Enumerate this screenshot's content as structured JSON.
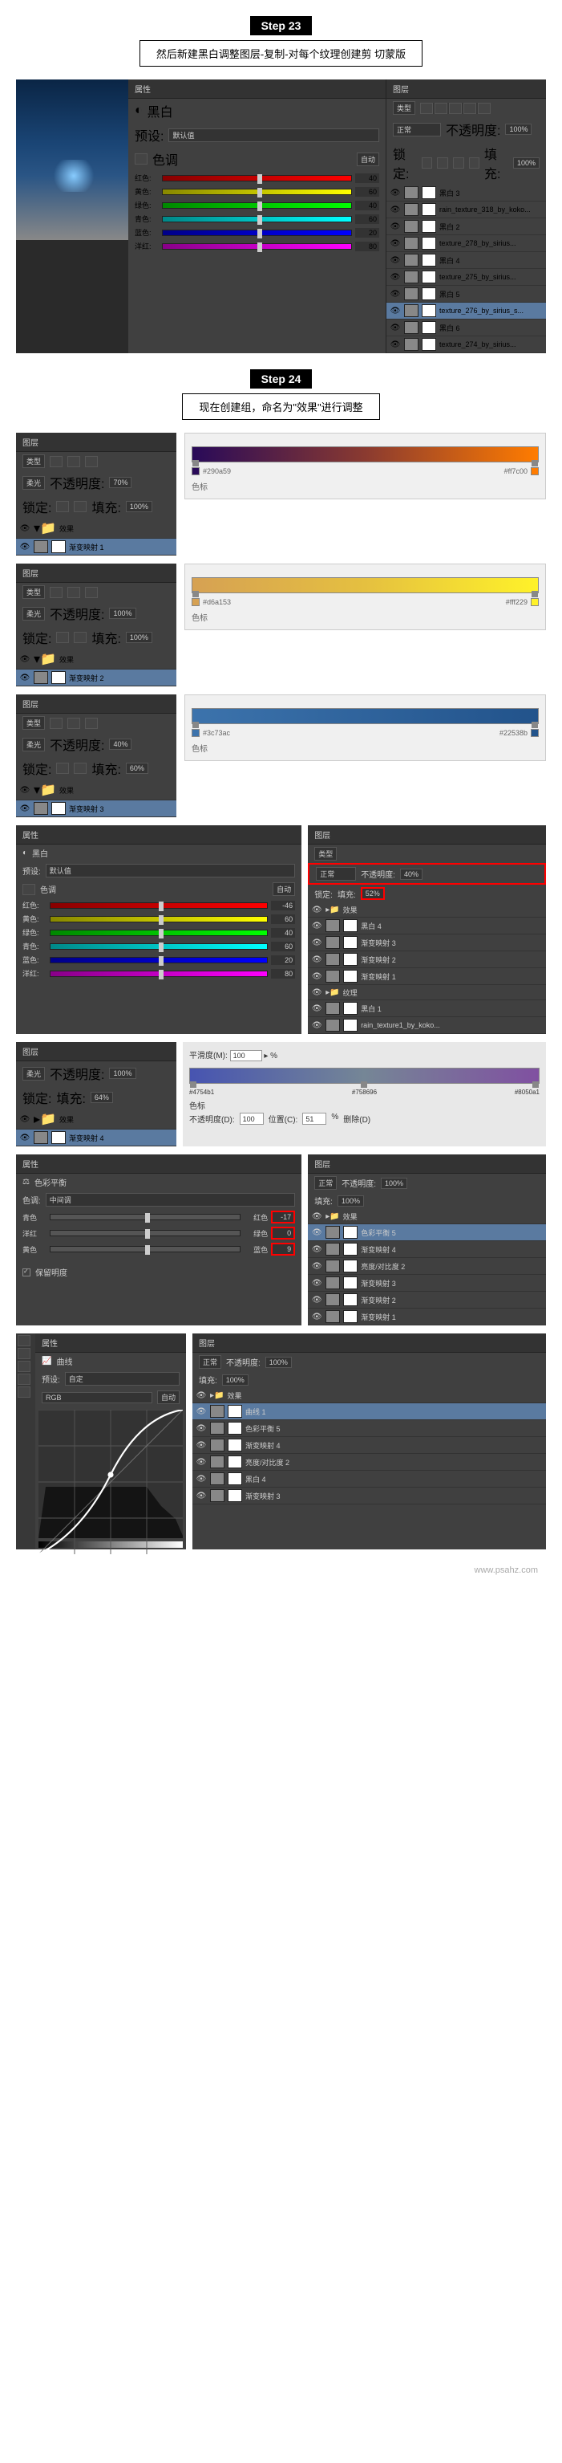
{
  "steps": {
    "s23": {
      "badge": "Step 23",
      "desc": "然后新建黑白调整图层-复制-对每个纹理创建剪\n切蒙版"
    },
    "s24": {
      "badge": "Step 24",
      "desc": "现在创建组，命名为\"效果\"进行调整"
    }
  },
  "bw_panel": {
    "title": "属性",
    "type": "黑白",
    "preset_label": "预设:",
    "preset": "默认值",
    "tint_label": "色调",
    "auto": "自动",
    "sliders": [
      {
        "label": "红色:",
        "val": "40",
        "grad": "linear-gradient(to right,#800,#f00)"
      },
      {
        "label": "黄色:",
        "val": "60",
        "grad": "linear-gradient(to right,#880,#ff0)"
      },
      {
        "label": "绿色:",
        "val": "40",
        "grad": "linear-gradient(to right,#080,#0f0)"
      },
      {
        "label": "青色:",
        "val": "60",
        "grad": "linear-gradient(to right,#088,#0ff)"
      },
      {
        "label": "蓝色:",
        "val": "20",
        "grad": "linear-gradient(to right,#008,#00f)"
      },
      {
        "label": "洋红:",
        "val": "80",
        "grad": "linear-gradient(to right,#808,#f0f)"
      }
    ]
  },
  "layers_23": {
    "title": "图层",
    "kind": "类型",
    "blend": "正常",
    "opacity_label": "不透明度:",
    "opacity": "100%",
    "lock": "锁定:",
    "fill_label": "填充:",
    "fill": "100%",
    "items": [
      {
        "name": "黑白 3",
        "sel": false
      },
      {
        "name": "rain_texture_318_by_koko...",
        "sel": false
      },
      {
        "name": "黑白 2",
        "sel": false
      },
      {
        "name": "texture_278_by_sirius...",
        "sel": false
      },
      {
        "name": "黑白 4",
        "sel": false
      },
      {
        "name": "texture_275_by_sirius...",
        "sel": false
      },
      {
        "name": "黑白 5",
        "sel": false
      },
      {
        "name": "texture_276_by_sirius_s...",
        "sel": true
      },
      {
        "name": "黑白 6",
        "sel": false
      },
      {
        "name": "texture_274_by_sirius...",
        "sel": false
      }
    ]
  },
  "gradients": [
    {
      "opacity": "70%",
      "fill": "100%",
      "layer": "渐变映射 1",
      "c1": "#290a59",
      "c2": "#ff7c00",
      "grad": "linear-gradient(to right,#290a59,#8a3a30,#ff7c00)"
    },
    {
      "opacity": "100%",
      "fill": "100%",
      "layer": "渐变映射 2",
      "c1": "#d6a153",
      "c2": "#fff229",
      "grad": "linear-gradient(to right,#d6a153,#e5c040,#fff229)"
    },
    {
      "opacity": "40%",
      "fill": "60%",
      "layer": "渐变映射 3",
      "c1": "#3c73ac",
      "c2": "#22538b",
      "grad": "linear-gradient(to right,#3c73ac,#2f639c,#22538b)"
    }
  ],
  "grad_labels": {
    "panel": "图层",
    "kind": "类型",
    "blend": "柔光",
    "opacity_label": "不透明度:",
    "lock": "锁定:",
    "fill_label": "填充:",
    "group": "效果",
    "color_label": "色标"
  },
  "bw_panel2": {
    "sliders": [
      {
        "label": "红色:",
        "val": "-46",
        "grad": "linear-gradient(to right,#800,#f00)"
      },
      {
        "label": "黄色:",
        "val": "60",
        "grad": "linear-gradient(to right,#880,#ff0)"
      },
      {
        "label": "绿色:",
        "val": "40",
        "grad": "linear-gradient(to right,#080,#0f0)"
      },
      {
        "label": "青色:",
        "val": "60",
        "grad": "linear-gradient(to right,#088,#0ff)"
      },
      {
        "label": "蓝色:",
        "val": "20",
        "grad": "linear-gradient(to right,#008,#00f)"
      },
      {
        "label": "洋红:",
        "val": "80",
        "grad": "linear-gradient(to right,#808,#f0f)"
      }
    ]
  },
  "layers_fx1": {
    "opacity": "40%",
    "fill": "52%",
    "items": [
      {
        "name": "效果",
        "folder": true
      },
      {
        "name": "黑白 4"
      },
      {
        "name": "渐变映射 3"
      },
      {
        "name": "渐变映射 2"
      },
      {
        "name": "渐变映射 1"
      },
      {
        "name": "纹理",
        "folder": true
      },
      {
        "name": "黑白 1"
      },
      {
        "name": "rain_texture1_by_koko..."
      }
    ]
  },
  "smoothness": {
    "label": "平滑度(M):",
    "val": "100",
    "pct": "%",
    "stops_label": "色标",
    "opacity_d": "不透明度(D):",
    "loc": "位置(C):",
    "del": "删除(D)",
    "c1": "#4754b1",
    "c2": "#758696",
    "c3": "#8050a1"
  },
  "grad4": {
    "opacity": "100%",
    "fill": "64%",
    "layer": "渐变映射 4"
  },
  "color_balance": {
    "title": "属性",
    "type": "色彩平衡",
    "tone_label": "色调:",
    "tone": "中间调",
    "rows": [
      {
        "l": "青色",
        "r": "红色",
        "v": "-17"
      },
      {
        "l": "洋红",
        "r": "绿色",
        "v": "0"
      },
      {
        "l": "黄色",
        "r": "蓝色",
        "v": "9"
      }
    ],
    "preserve": "保留明度"
  },
  "layers_fx2": {
    "opacity": "100%",
    "fill": "100%",
    "items": [
      {
        "name": "效果",
        "folder": true
      },
      {
        "name": "色彩平衡 5",
        "sel": true
      },
      {
        "name": "渐变映射 4"
      },
      {
        "name": "亮度/对比度 2"
      },
      {
        "name": "渐变映射 3"
      },
      {
        "name": "渐变映射 2"
      },
      {
        "name": "渐变映射 1"
      }
    ]
  },
  "curves": {
    "title": "属性",
    "type": "曲线",
    "preset_label": "预设:",
    "preset": "自定",
    "channel": "RGB",
    "auto": "自动"
  },
  "layers_fx3": {
    "opacity": "100%",
    "fill": "100%",
    "items": [
      {
        "name": "效果",
        "folder": true
      },
      {
        "name": "曲线 1",
        "sel": true
      },
      {
        "name": "色彩平衡 5"
      },
      {
        "name": "渐变映射 4"
      },
      {
        "name": "亮度/对比度 2"
      },
      {
        "name": "黑白 4"
      },
      {
        "name": "渐变映射 3"
      }
    ]
  },
  "watermark": "www.psahz.com"
}
